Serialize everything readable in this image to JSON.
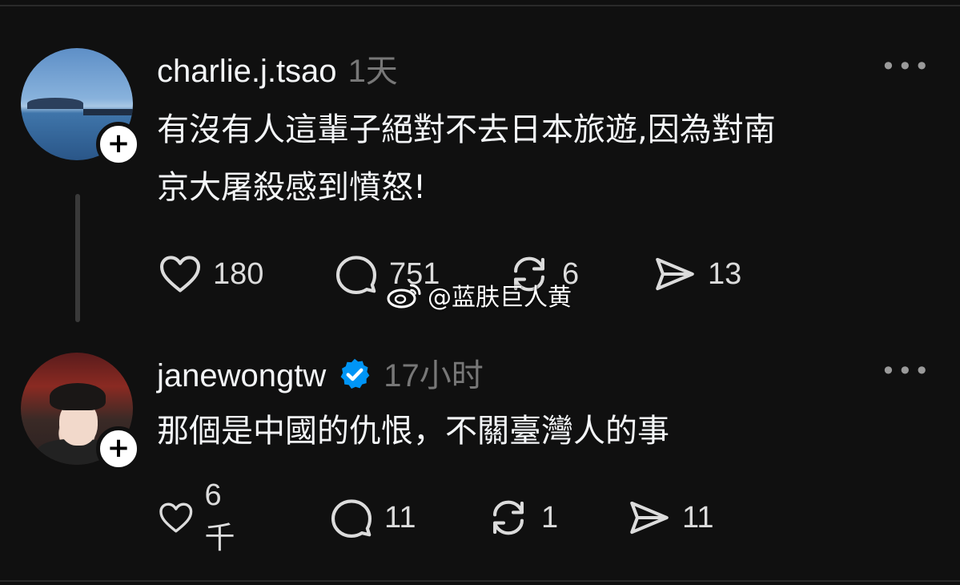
{
  "posts": [
    {
      "username": "charlie.j.tsao",
      "time": "1天",
      "text_line1": "有沒有人這輩子絕對不去日本旅遊,因為對南",
      "text_line2": "京大屠殺感到憤怒!",
      "likes": "180",
      "replies": "751",
      "reposts": "6",
      "shares": "13",
      "verified": false
    },
    {
      "username": "janewongtw",
      "time": "17小时",
      "text_line1": "那個是中國的仇恨，不關臺灣人的事",
      "likes": "6千",
      "replies": "11",
      "reposts": "1",
      "shares": "11",
      "verified": true
    }
  ],
  "follow_symbol": "+",
  "more_symbol": "•••",
  "watermark": "@蓝肤巨人黄",
  "colors": {
    "background": "#101010",
    "text": "#f3f5f7",
    "meta": "#777777",
    "verified_badge": "#0095f6"
  },
  "icons": [
    "heart-icon",
    "comment-icon",
    "repost-icon",
    "share-icon",
    "more-icon",
    "verified-badge-icon",
    "weibo-logo-icon"
  ]
}
